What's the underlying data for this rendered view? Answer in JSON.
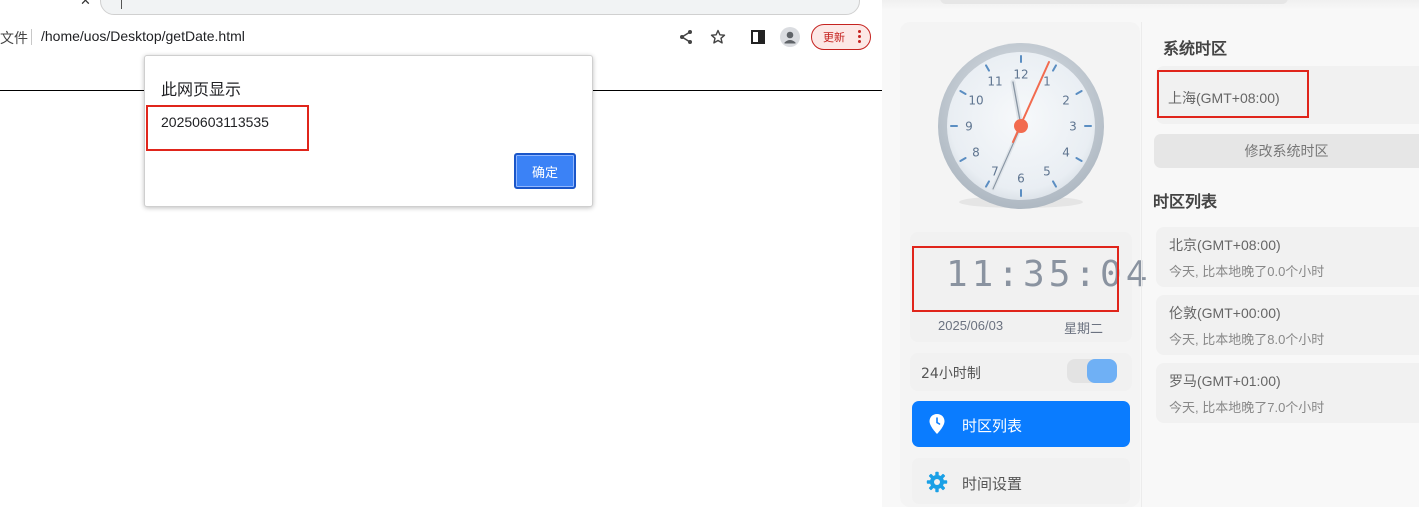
{
  "browser": {
    "file_label": "文件",
    "url": "/home/uos/Desktop/getDate.html",
    "update_label": "更新"
  },
  "dialog": {
    "title": "此网页显示",
    "message": "20250603113535",
    "ok_label": "确定"
  },
  "clock": {
    "dial_numbers": [
      "12",
      "1",
      "2",
      "3",
      "4",
      "5",
      "6",
      "7",
      "8",
      "9",
      "10",
      "11"
    ],
    "digital_time": "11:35:04",
    "date": "2025/06/03",
    "weekday": "星期二",
    "hour_format_label": "24小时制",
    "hour_format_enabled": true,
    "nav": {
      "timezone_list": "时区列表",
      "time_settings": "时间设置"
    }
  },
  "timezone": {
    "system_title": "系统时区",
    "system_value": "上海(GMT+08:00)",
    "modify_label": "修改系统时区",
    "list_title": "时区列表",
    "list": [
      {
        "name": "北京(GMT+08:00)",
        "desc": "今天, 比本地晚了0.0个小时"
      },
      {
        "name": "伦敦(GMT+00:00)",
        "desc": "今天, 比本地晚了8.0个小时"
      },
      {
        "name": "罗马(GMT+01:00)",
        "desc": "今天, 比本地晚了7.0个小时"
      }
    ]
  },
  "colors": {
    "accent": "#0a7cff",
    "highlight_box": "#e0251b",
    "second_hand": "#f26b4f",
    "toggle_on": "#6fb0f5"
  }
}
